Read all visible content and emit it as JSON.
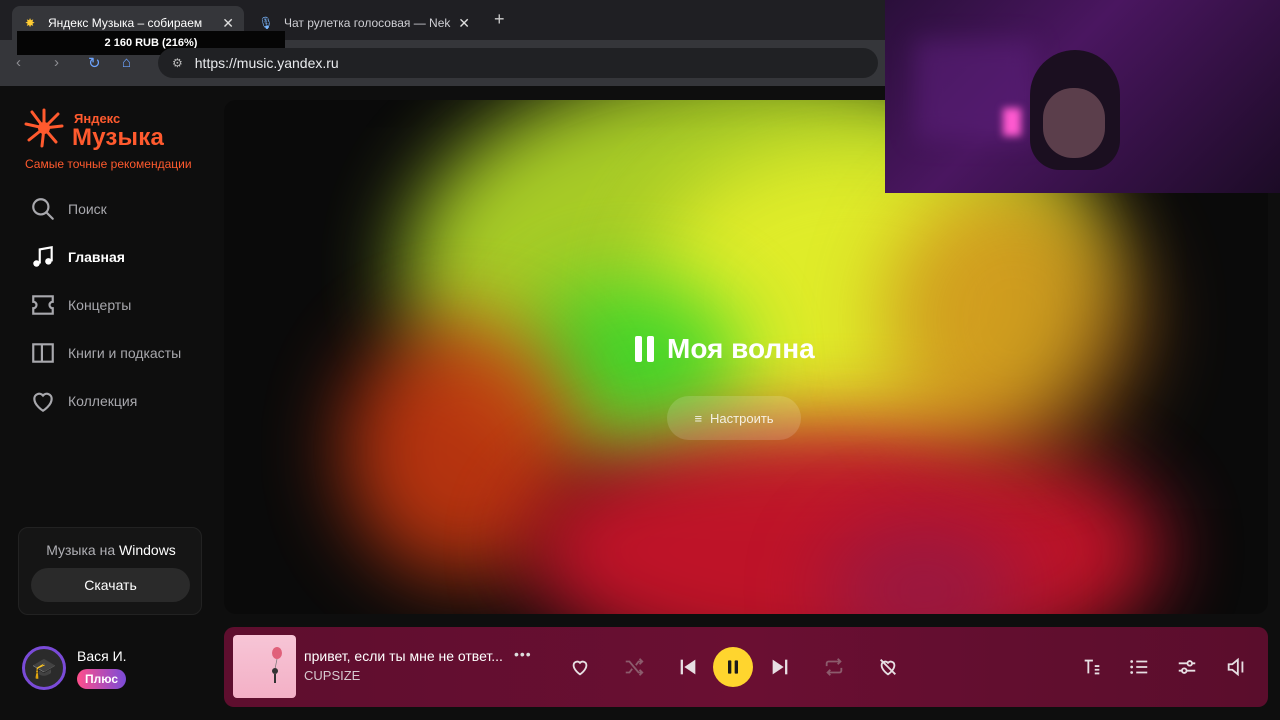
{
  "browser": {
    "tabs": [
      {
        "title": "Яндекс Музыка – собираем",
        "close": "✕"
      },
      {
        "title": "Чат рулетка голосовая — Nek",
        "close": "✕"
      }
    ],
    "new_tab": "+",
    "donation_overlay": "2 160 RUB (216%)",
    "url": "https://music.yandex.ru"
  },
  "logo": {
    "small": "Яндекс",
    "big": "Музыка",
    "tagline": "Самые точные рекомендации"
  },
  "nav": [
    {
      "label": "Поиск",
      "icon": "search-icon"
    },
    {
      "label": "Главная",
      "icon": "music-note-icon",
      "active": true
    },
    {
      "label": "Концерты",
      "icon": "ticket-icon"
    },
    {
      "label": "Книги и подкасты",
      "icon": "book-icon"
    },
    {
      "label": "Коллекция",
      "icon": "heart-icon"
    }
  ],
  "promo": {
    "title_prefix": "Музыка на ",
    "title_platform": "Windows",
    "button": "Скачать"
  },
  "user": {
    "name": "Вася И.",
    "badge": "Плюс"
  },
  "wave": {
    "title": "Моя волна",
    "settings": "Настроить"
  },
  "player": {
    "track_title": "привет, если ты мне не ответ...",
    "more": "•••",
    "artist": "CUPSIZE"
  },
  "colors": {
    "accent": "#ff5a2e",
    "play": "#ffd52e",
    "player_bg": "#5e0e2e"
  }
}
